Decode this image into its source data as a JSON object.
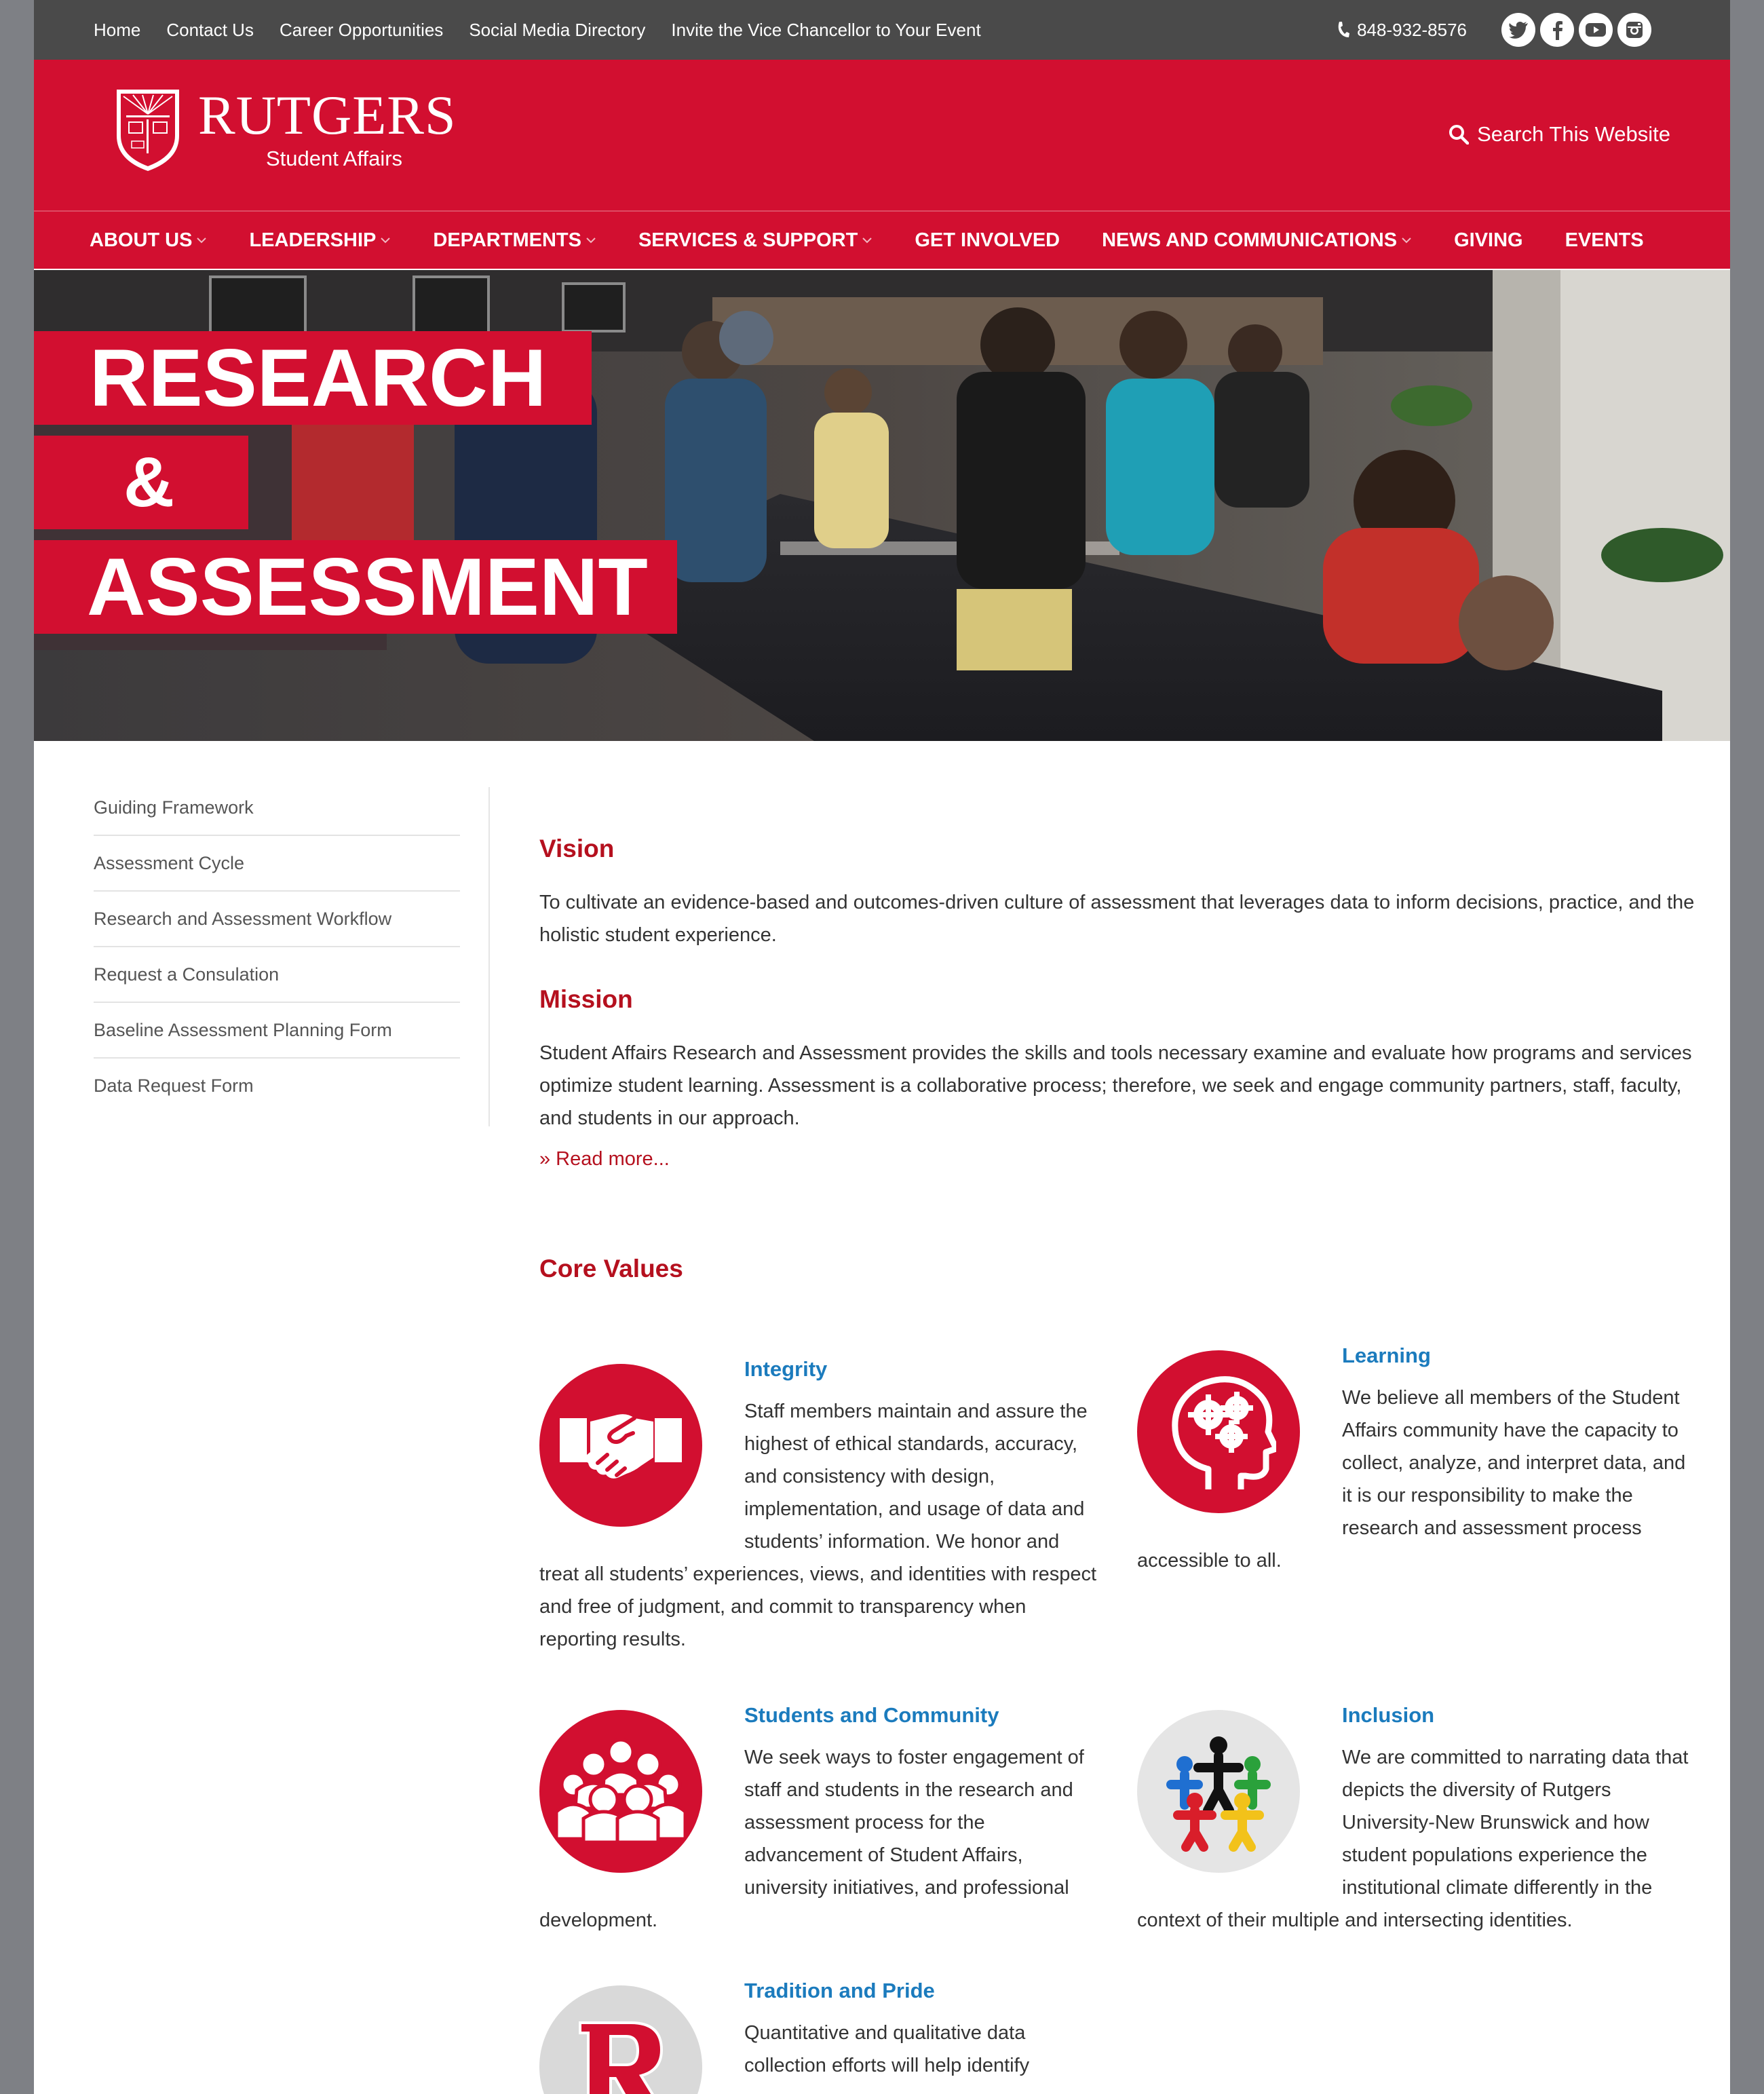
{
  "utility": {
    "links": [
      "Home",
      "Contact Us",
      "Career Opportunities",
      "Social Media Directory",
      "Invite the Vice Chancellor to Your Event"
    ],
    "phone": "848-932-8576",
    "social_icons": [
      "twitter-icon",
      "facebook-icon",
      "youtube-icon",
      "instagram-icon"
    ]
  },
  "brand": {
    "name": "RUTGERS",
    "sub": "Student Affairs",
    "search_label": "Search This Website",
    "color": "#d20f30"
  },
  "nav": {
    "items": [
      {
        "label": "ABOUT US",
        "dropdown": true
      },
      {
        "label": "LEADERSHIP",
        "dropdown": true
      },
      {
        "label": "DEPARTMENTS",
        "dropdown": true
      },
      {
        "label": "SERVICES & SUPPORT",
        "dropdown": true
      },
      {
        "label": "GET INVOLVED",
        "dropdown": false
      },
      {
        "label": "NEWS AND COMMUNICATIONS",
        "dropdown": true
      },
      {
        "label": "GIVING",
        "dropdown": false
      },
      {
        "label": "EVENTS",
        "dropdown": false
      }
    ]
  },
  "hero": {
    "line1": "RESEARCH",
    "line2": "&",
    "line3": "ASSESSMENT"
  },
  "sidebar": {
    "items": [
      "Guiding Framework",
      "Assessment Cycle",
      "Research and Assessment Workflow",
      "Request a Consulation",
      "Baseline Assessment Planning Form",
      "Data Request Form"
    ]
  },
  "main": {
    "vision_title": "Vision",
    "vision_text": "To cultivate an evidence-based and outcomes-driven culture of assessment that leverages data to inform decisions, practice, and the holistic student experience.",
    "mission_title": "Mission",
    "mission_text": "Student Affairs Research and Assessment provides the skills and tools necessary examine and evaluate how programs and services optimize student learning.  Assessment is a collaborative process; therefore, we seek and engage community partners, staff, faculty, and students in our approach.",
    "read_more": "» Read more...",
    "core_values_title": "Core Values",
    "values": [
      {
        "title": "Integrity",
        "icon": "handshake-icon",
        "text": "Staff members maintain and assure the highest of ethical standards, accuracy, and consistency with design, implementation, and usage of data and students’ information.  We honor and treat all students’ experiences, views, and identities with respect and free of judgment, and commit to transparency when reporting results."
      },
      {
        "title": "Learning",
        "icon": "head-gears-icon",
        "text": "We believe all members of the Student Affairs community have the capacity to collect, analyze, and interpret data, and it is our responsibility to make the research and assessment process accessible to all."
      },
      {
        "title": "Students and Community",
        "icon": "people-group-icon",
        "text": "We seek ways to foster engagement of staff and students in the research and assessment process for the advancement of Student Affairs, university initiatives, and professional development."
      },
      {
        "title": "Inclusion",
        "icon": "diverse-people-icon",
        "text": "We are committed to narrating data that depicts the diversity of Rutgers University-New Brunswick and how student populations experience the institutional climate differently in the context of their multiple and intersecting identities."
      },
      {
        "title": "Tradition and Pride",
        "icon": "rutgers-r-icon",
        "text": "Quantitative and qualitative data collection efforts will help identify"
      }
    ]
  }
}
